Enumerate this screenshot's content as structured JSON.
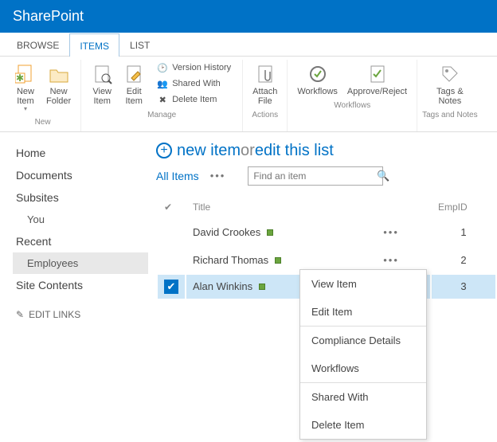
{
  "header": {
    "app": "SharePoint"
  },
  "ribbonTabs": [
    "BROWSE",
    "ITEMS",
    "LIST"
  ],
  "activeTab": 1,
  "ribbon": {
    "new": {
      "newItem": "New\nItem",
      "newFolder": "New\nFolder",
      "label": "New"
    },
    "manage": {
      "viewItem": "View\nItem",
      "editItem": "Edit\nItem",
      "versionHistory": "Version History",
      "sharedWith": "Shared With",
      "deleteItem": "Delete Item",
      "label": "Manage"
    },
    "actions": {
      "attachFile": "Attach\nFile",
      "label": "Actions"
    },
    "workflows": {
      "workflows": "Workflows",
      "approve": "Approve/Reject",
      "label": "Workflows"
    },
    "tags": {
      "tagsNotes": "Tags &\nNotes",
      "label": "Tags and Notes"
    }
  },
  "nav": {
    "home": "Home",
    "documents": "Documents",
    "subsites": "Subsites",
    "you": "You",
    "recent": "Recent",
    "employees": "Employees",
    "siteContents": "Site Contents",
    "editLinks": "EDIT LINKS"
  },
  "main": {
    "newItem": "new item",
    "or": " or ",
    "editList": "edit this list",
    "allItems": "All Items",
    "searchPlaceholder": "Find an item",
    "cols": {
      "title": "Title",
      "empid": "EmpID"
    },
    "rows": [
      {
        "title": "David Crookes",
        "empid": "1",
        "selected": false
      },
      {
        "title": "Richard Thomas",
        "empid": "2",
        "selected": false
      },
      {
        "title": "Alan Winkins",
        "empid": "3",
        "selected": true
      }
    ]
  },
  "context": {
    "viewItem": "View Item",
    "editItem": "Edit Item",
    "compliance": "Compliance Details",
    "workflows": "Workflows",
    "sharedWith": "Shared With",
    "deleteItem": "Delete Item"
  }
}
